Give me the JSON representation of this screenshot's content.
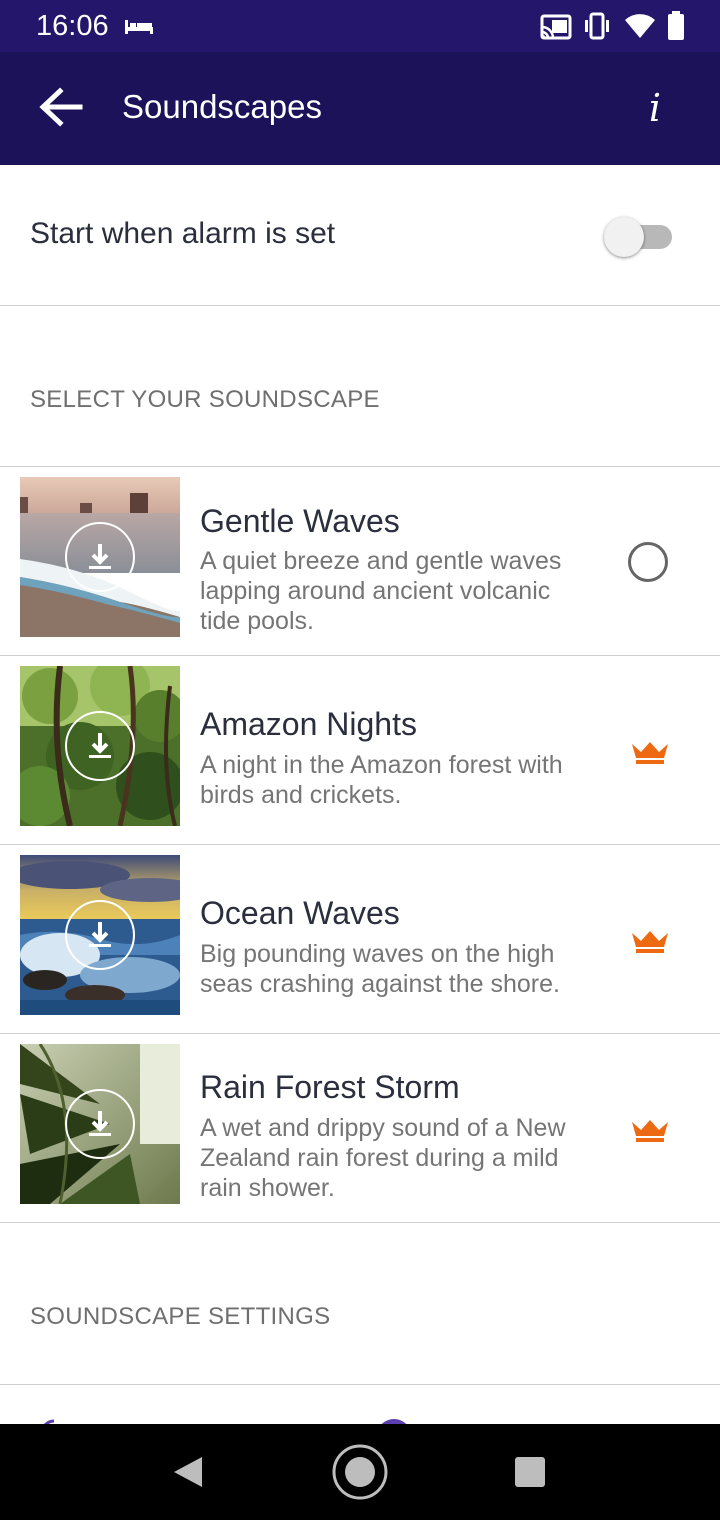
{
  "status": {
    "time": "16:06",
    "icons": [
      "bed-icon",
      "cast-icon",
      "vibrate-icon",
      "wifi-icon",
      "battery-icon"
    ]
  },
  "header": {
    "title": "Soundscapes",
    "info_label": "i"
  },
  "alarm_toggle": {
    "label": "Start when alarm is set",
    "on": false
  },
  "sections": {
    "select_title": "SELECT YOUR SOUNDSCAPE",
    "settings_title": "SOUNDSCAPE SETTINGS"
  },
  "soundscapes": [
    {
      "title": "Gentle Waves",
      "desc_lines": [
        "A quiet breeze and gentle waves",
        "lapping around ancient volcanic",
        "tide pools."
      ],
      "indicator": "radio-unselected",
      "thumb": "beach-waves-photo"
    },
    {
      "title": "Amazon Nights",
      "desc_lines": [
        "A night in the Amazon forest with",
        "birds and crickets."
      ],
      "indicator": "crown-icon",
      "thumb": "jungle-photo"
    },
    {
      "title": "Ocean Waves",
      "desc_lines": [
        "Big pounding waves on the high",
        "seas crashing against the shore."
      ],
      "indicator": "crown-icon",
      "thumb": "ocean-sunset-photo"
    },
    {
      "title": "Rain Forest Storm",
      "desc_lines": [
        "A wet and drippy sound of a New",
        "Zealand rain forest during a mild",
        "rain shower."
      ],
      "indicator": "crown-icon",
      "thumb": "rainforest-photo"
    }
  ],
  "colors": {
    "status_bar": "#24176b",
    "app_bar": "#1b1259",
    "crown": "#ee6a12",
    "text_primary": "#2a2e3d",
    "text_secondary": "#757575"
  }
}
